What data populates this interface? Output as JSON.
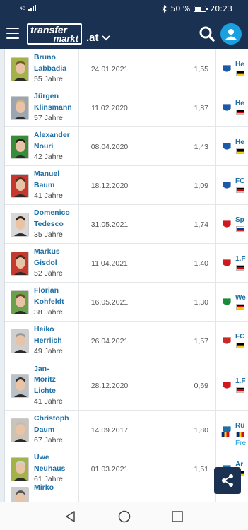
{
  "status_bar": {
    "signal_label": "4G",
    "battery_text": "50 %",
    "time": "20:23"
  },
  "header": {
    "logo_line1": "transfer",
    "logo_line2": "markt",
    "domain": ".at"
  },
  "rows": [
    {
      "first": "Bruno",
      "last": "Labbadia",
      "age": "55 Jahre",
      "date": "24.01.2021",
      "ppm": "1,55",
      "club": "He",
      "club_color": "#1c5aa8",
      "photo_bg": "#a4b24a",
      "hair": "#7a5a2f",
      "flag": "de"
    },
    {
      "first": "Jürgen",
      "last": "Klinsmann",
      "age": "57 Jahre",
      "date": "11.02.2020",
      "ppm": "1,87",
      "club": "He",
      "club_color": "#1c5aa8",
      "photo_bg": "#9aa6b2",
      "hair": "#c9b48a",
      "flag": "de"
    },
    {
      "first": "Alexander",
      "last": "Nouri",
      "age": "42 Jahre",
      "date": "08.04.2020",
      "ppm": "1,43",
      "club": "He",
      "club_color": "#1c5aa8",
      "photo_bg": "#3b8c3a",
      "hair": "#2a1e17",
      "flag": "de"
    },
    {
      "first": "Manuel",
      "last": "Baum",
      "age": "41 Jahre",
      "date": "18.12.2020",
      "ppm": "1,09",
      "club": "FC",
      "club_color": "#1c5aa8",
      "photo_bg": "#c8372f",
      "hair": "#4a3322",
      "flag": "de"
    },
    {
      "first": "Domenico",
      "last": "Tedesco",
      "age": "35 Jahre",
      "date": "31.05.2021",
      "ppm": "1,74",
      "club": "Sp",
      "club_color": "#d0181f",
      "photo_bg": "#d8d8d8",
      "hair": "#2a1e17",
      "flag": "ru"
    },
    {
      "first": "Markus",
      "last": "Gisdol",
      "age": "52 Jahre",
      "date": "11.04.2021",
      "ppm": "1,40",
      "club": "1.F",
      "club_color": "#d0181f",
      "photo_bg": "#c53a2e",
      "hair": "#3c2a1e",
      "flag": "de"
    },
    {
      "first": "Florian",
      "last": "Kohfeldt",
      "age": "38 Jahre",
      "date": "16.05.2021",
      "ppm": "1,30",
      "club": "We",
      "club_color": "#1d8a3a",
      "photo_bg": "#6aa24c",
      "hair": "#6b4a2b",
      "flag": "de"
    },
    {
      "first": "Heiko",
      "last": "Herrlich",
      "age": "49 Jahre",
      "date": "26.04.2021",
      "ppm": "1,57",
      "club": "FC",
      "club_color": "#c42d27",
      "photo_bg": "#cfcfcf",
      "hair": "#9a9a9a",
      "flag": "de"
    },
    {
      "first": "Jan-",
      "last": "Moritz",
      "last2": "Lichte",
      "age": "41 Jahre",
      "date": "28.12.2020",
      "ppm": "0,69",
      "club": "1.F",
      "club_color": "#d0181f",
      "photo_bg": "#b9c2c9",
      "hair": "#2e2e2e",
      "flag": "de"
    },
    {
      "first": "Christoph",
      "last": "Daum",
      "age": "67 Jahre",
      "date": "14.09.2017",
      "ppm": "1,80",
      "club": "Ru",
      "club_color": "#1d6fa5",
      "photo_bg": "#c9c3b8",
      "hair": "#bdbdbd",
      "flag": "ro",
      "extra": "Fre"
    },
    {
      "first": "Uwe",
      "last": "Neuhaus",
      "age": "61 Jahre",
      "date": "01.03.2021",
      "ppm": "1,51",
      "club": "Ar",
      "club_color": "#1d6fa5",
      "photo_bg": "#a4b24a",
      "hair": "#d0d0d0",
      "flag": "de"
    },
    {
      "first": "Mirko",
      "last": "",
      "age": "",
      "date": "",
      "ppm": "",
      "club": "",
      "club_color": "#1d6fa5",
      "photo_bg": "#cccccc",
      "hair": "#555555",
      "flag": ""
    }
  ]
}
